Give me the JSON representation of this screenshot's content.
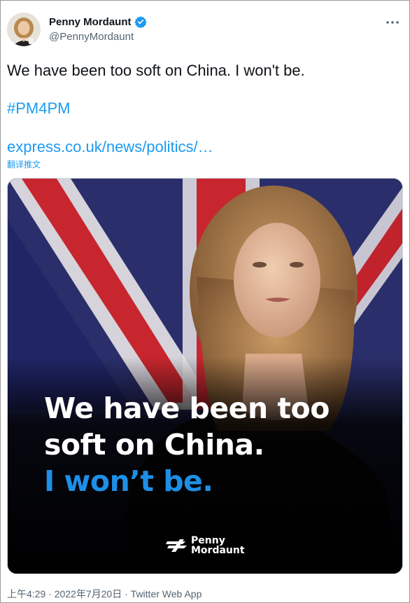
{
  "author": {
    "display_name": "Penny Mordaunt",
    "handle": "@PennyMordaunt",
    "verified_icon": "verified-badge-icon",
    "avatar_icon": "avatar-photo"
  },
  "tweet": {
    "text": "We have been too soft on China. I won't be.",
    "hashtag": "#PM4PM",
    "link_text": "express.co.uk/news/politics/…",
    "translate_label": "翻译推文"
  },
  "media": {
    "headline_line1": "We have been too",
    "headline_line2": "soft on China.",
    "headline_line3": "I won’t be.",
    "brand_line1": "Penny",
    "brand_line2": "Mordaunt",
    "colors": {
      "headline_white": "#ffffff",
      "headline_blue": "#1d8fe6",
      "background": "#0a0a0a"
    }
  },
  "meta": {
    "time": "上午4:29",
    "separator": "·",
    "date": "2022年7月20日",
    "source": "Twitter Web App"
  },
  "colors": {
    "link": "#1d9bf0",
    "muted": "#536471",
    "text": "#0f1419"
  }
}
